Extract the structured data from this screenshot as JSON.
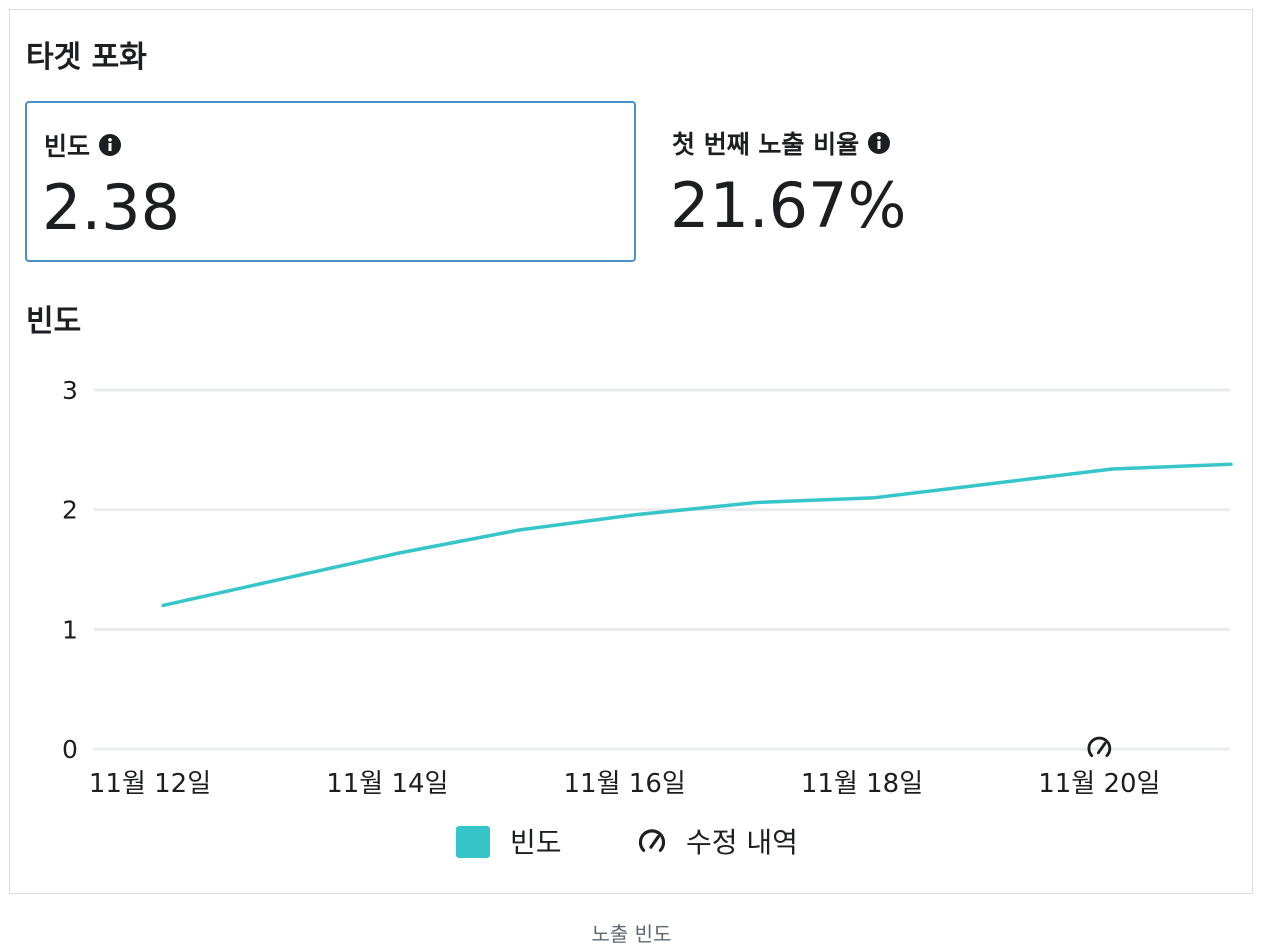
{
  "section": {
    "title": "타겟 포화"
  },
  "metrics": [
    {
      "label": "빈도",
      "value": "2.38"
    },
    {
      "label": "첫 번째 노출 비율",
      "value": "21.67%"
    }
  ],
  "chart_title": "빈도",
  "footer_caption": "노출 빈도",
  "colors": {
    "series": "#36c5c8",
    "selected_border": "#4a90c9",
    "grid": "#e9ebee"
  },
  "icons": {
    "info": "info-icon",
    "edit_history": "gauge-edit-icon"
  },
  "chart_data": {
    "type": "line",
    "title": "빈도",
    "xlabel": "",
    "ylabel": "",
    "x": [
      "11월 12일",
      "11월 13일",
      "11월 14일",
      "11월 15일",
      "11월 16일",
      "11월 17일",
      "11월 18일",
      "11월 19일",
      "11월 20일",
      "11월 21일"
    ],
    "x_tick_labels": [
      "11월 12일",
      "11월 14일",
      "11월 16일",
      "11월 18일",
      "11월 20일"
    ],
    "y_ticks": [
      0,
      1,
      2,
      3
    ],
    "ylim": [
      0,
      3
    ],
    "grid": true,
    "series": [
      {
        "name": "빈도",
        "values": [
          1.2,
          1.42,
          1.64,
          1.83,
          1.96,
          2.06,
          2.1,
          2.22,
          2.34,
          2.38
        ]
      }
    ],
    "markers": [
      {
        "x": "11월 20일",
        "icon": "gauge-edit-icon"
      }
    ],
    "legend": {
      "position": "bottom",
      "items": [
        {
          "label": "빈도",
          "icon": "square-swatch"
        },
        {
          "label": "수정 내역",
          "icon": "gauge-edit-icon"
        }
      ]
    }
  }
}
